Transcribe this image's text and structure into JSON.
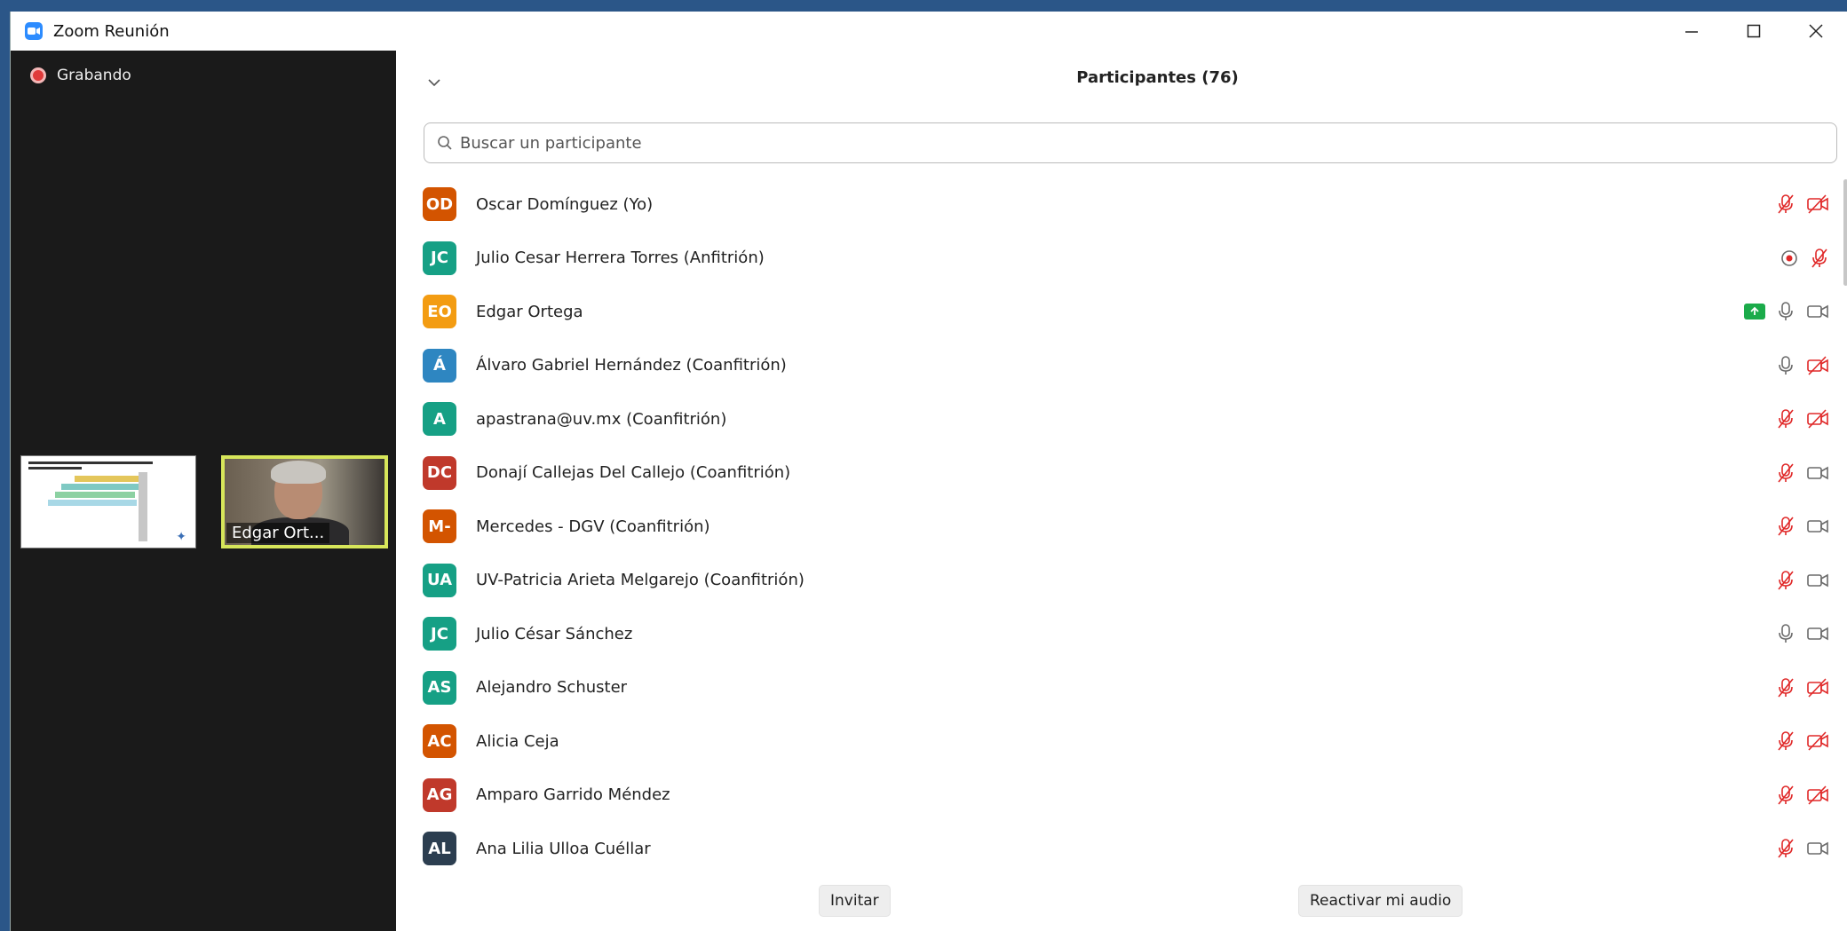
{
  "window": {
    "title": "Zoom Reunión",
    "controls": [
      "minimize-icon",
      "maximize-icon",
      "close-icon"
    ]
  },
  "left_panel": {
    "recording_label": "Grabando",
    "video_tile_name": "Edgar Ort..."
  },
  "participants_panel": {
    "title": "Participantes (76)",
    "search_placeholder": "Buscar un participante",
    "participants": [
      {
        "initials": "OD",
        "name": "Oscar Domínguez (Yo)",
        "color": "#d35400",
        "icons": [
          "mic-muted",
          "video-off"
        ]
      },
      {
        "initials": "JC",
        "name": "Julio Cesar Herrera Torres (Anfitrión)",
        "color": "#16a085",
        "icons": [
          "recording",
          "mic-muted"
        ]
      },
      {
        "initials": "EO",
        "name": "Edgar Ortega",
        "color": "#f39c12",
        "icons": [
          "share-screen",
          "mic-on",
          "video-on"
        ]
      },
      {
        "initials": "Á",
        "name": "Álvaro Gabriel Hernández (Coanfitrión)",
        "color": "#2e86c1",
        "icons": [
          "mic-on",
          "video-off"
        ]
      },
      {
        "initials": "A",
        "name": "apastrana@uv.mx (Coanfitrión)",
        "color": "#16a085",
        "icons": [
          "mic-muted",
          "video-off"
        ]
      },
      {
        "initials": "DC",
        "name": "Donají Callejas Del Callejo (Coanfitrión)",
        "color": "#c0392b",
        "icons": [
          "mic-muted",
          "video-on"
        ]
      },
      {
        "initials": "M-",
        "name": "Mercedes - DGV (Coanfitrión)",
        "color": "#d35400",
        "icons": [
          "mic-muted",
          "video-on"
        ]
      },
      {
        "initials": "UA",
        "name": "UV-Patricia Arieta Melgarejo (Coanfitrión)",
        "color": "#16a085",
        "icons": [
          "mic-muted",
          "video-on"
        ]
      },
      {
        "initials": "JC",
        "name": "Julio César Sánchez",
        "color": "#16a085",
        "icons": [
          "mic-on",
          "video-on"
        ]
      },
      {
        "initials": "AS",
        "name": "Alejandro Schuster",
        "color": "#16a085",
        "icons": [
          "mic-muted",
          "video-off"
        ]
      },
      {
        "initials": "AC",
        "name": "Alicia Ceja",
        "color": "#d35400",
        "icons": [
          "mic-muted",
          "video-off"
        ]
      },
      {
        "initials": "AG",
        "name": "Amparo Garrido Méndez",
        "color": "#c0392b",
        "icons": [
          "mic-muted",
          "video-off"
        ]
      },
      {
        "initials": "AL",
        "name": "Ana Lilia Ulloa Cuéllar",
        "color": "#2c3e50",
        "icons": [
          "mic-muted",
          "video-on"
        ]
      }
    ],
    "invite_label": "Invitar",
    "unmute_label": "Reactivar mi audio"
  },
  "colors": {
    "muted_red": "#e02828",
    "icon_gray": "#6b6b6b",
    "share_green": "#1bab4a",
    "zoom_blue": "#2d8cff"
  }
}
